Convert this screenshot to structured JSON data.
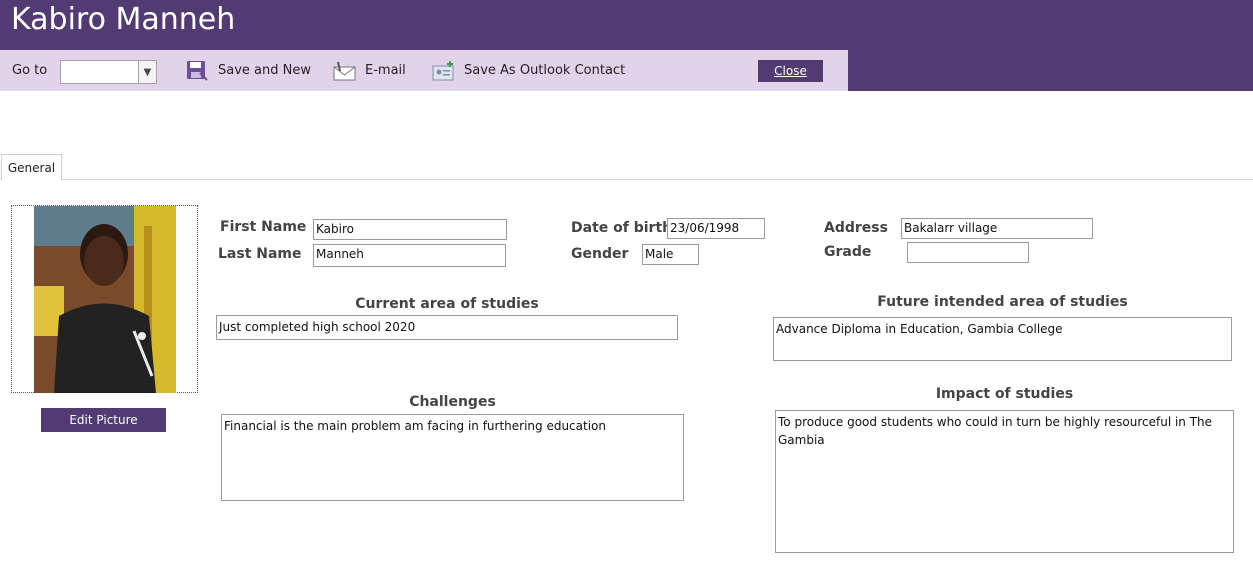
{
  "header": {
    "title": "Kabiro Manneh"
  },
  "toolbar": {
    "goto_label": "Go to",
    "goto_value": "",
    "save_new_label": "Save and New",
    "email_label": "E-mail",
    "outlook_label": "Save As Outlook Contact",
    "close_label": "Close"
  },
  "tabs": [
    {
      "label": "General"
    }
  ],
  "photo": {
    "edit_label": "Edit Picture"
  },
  "form": {
    "first_name_label": "First Name",
    "first_name": "Kabiro",
    "last_name_label": "Last Name",
    "last_name": "Manneh",
    "dob_label": "Date of birth",
    "dob": "23/06/1998",
    "gender_label": "Gender",
    "gender": "Male",
    "address_label": "Address",
    "address": "Bakalarr village",
    "grade_label": "Grade",
    "grade": "",
    "current_studies_label": "Current area of studies",
    "current_studies": "Just completed high school 2020",
    "future_studies_label": "Future intended area of studies",
    "future_studies": "Advance Diploma in Education, Gambia College",
    "challenges_label": "Challenges",
    "challenges": "Financial is the main problem am facing in furthering education",
    "impact_label": "Impact of studies",
    "impact": "To produce good students who could in turn be highly resourceful in The Gambia"
  },
  "colors": {
    "brand": "#523a72",
    "toolbar": "#e2d3eb"
  }
}
